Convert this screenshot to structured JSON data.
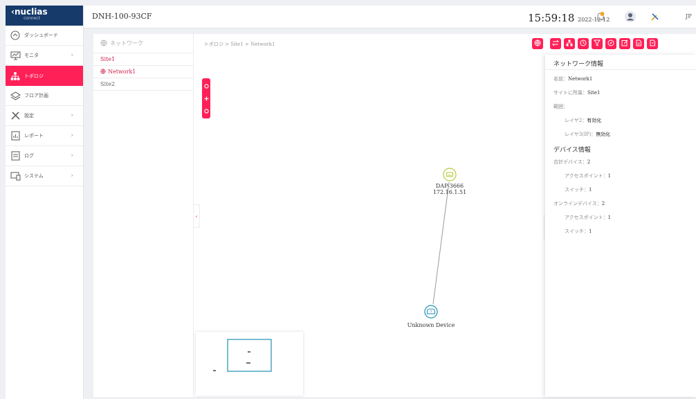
{
  "app": {
    "logo_brand": "nuclias",
    "logo_sub": "connect",
    "device_name": "DNH-100-93CF",
    "time": "15:59:18",
    "date": "2022-12-12",
    "language": "JP"
  },
  "sidebar": {
    "items": [
      {
        "label": "ダッシュボード",
        "icon": "dashboard-icon",
        "has_children": false
      },
      {
        "label": "モニタ",
        "icon": "monitor-icon",
        "has_children": true
      },
      {
        "label": "トポロジ",
        "icon": "topology-icon",
        "has_children": false,
        "active": true
      },
      {
        "label": "フロア計画",
        "icon": "floorplan-icon",
        "has_children": false
      },
      {
        "label": "設定",
        "icon": "settings-tools-icon",
        "has_children": true
      },
      {
        "label": "レポート",
        "icon": "report-icon",
        "has_children": true
      },
      {
        "label": "ログ",
        "icon": "log-icon",
        "has_children": true
      },
      {
        "label": "システム",
        "icon": "system-icon",
        "has_children": true
      }
    ]
  },
  "tree": {
    "header": "ネットワーク",
    "items": [
      {
        "label": "Site1"
      },
      {
        "label": "Network1"
      },
      {
        "label": "Site2"
      }
    ]
  },
  "breadcrumb": "トポロジ > Site1 > Network1",
  "toolbar": {
    "buttons": [
      "globe-icon",
      "swap-icon",
      "hierarchy-icon",
      "clock-icon",
      "filter-icon",
      "compass-icon",
      "edit-icon",
      "export-icon",
      "logout-icon"
    ]
  },
  "topology": {
    "nodes": [
      {
        "name": "DAP-3666",
        "ip": "172.16.1.51",
        "type": "access-point",
        "color": "#b7c83a"
      },
      {
        "name": "Unknown Device",
        "ip": "",
        "type": "unknown",
        "color": "#1f8fb3"
      }
    ]
  },
  "info_panel": {
    "title": "ネットワーク情報",
    "name_label": "名前：",
    "name_value": "Network1",
    "site_label": "サイトに所属：",
    "site_value": "Site1",
    "scope_label": "範囲：",
    "layer2_label": "レイヤ2：",
    "layer2_value": "有効化",
    "layer3_label": "レイヤ3(IP)：",
    "layer3_value": "無効化",
    "device_title": "デバイス情報",
    "total_label": "合計デバイス：",
    "total_value": "2",
    "ap_label": "アクセスポイント：",
    "ap_value": "1",
    "switch_label": "スイッチ：",
    "switch_value": "1",
    "online_label": "オンラインデバイス：",
    "online_value": "2",
    "online_ap_label": "アクセスポイント：",
    "online_ap_value": "1",
    "online_switch_label": "スイッチ：",
    "online_switch_value": "1"
  },
  "colors": {
    "accent": "#ff2057",
    "header_logo_bg": "#163b6b",
    "link_line": "#9a9a9a"
  }
}
